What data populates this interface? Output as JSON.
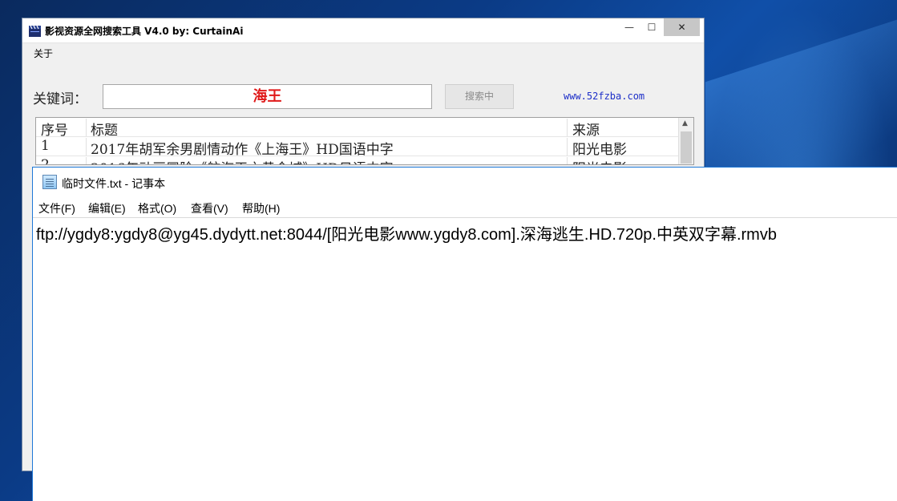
{
  "search_app": {
    "title": "影视资源全网搜索工具 V4.0 by:  CurtainAi",
    "menu": {
      "about": "关于"
    },
    "window_controls": {
      "minimize": "—",
      "maximize": "☐",
      "close": "✕"
    },
    "keyword_label": "关键词：",
    "keyword_value": "海王",
    "search_button_label": "搜索中",
    "site_link": "www.52fzba.com",
    "table": {
      "headers": [
        "序号",
        "标题",
        "来源"
      ],
      "rows": [
        [
          "1",
          "2017年胡军余男剧情动作《上海王》HD国语中字",
          "阳光电影"
        ],
        [
          "2",
          "2016年动画冒险《航海王之黄金城》HD日语中字",
          "阳光电影"
        ]
      ]
    }
  },
  "notepad": {
    "title": "临时文件.txt - 记事本",
    "menu": [
      "文件(F)",
      "编辑(E)",
      "格式(O)",
      "查看(V)",
      "帮助(H)"
    ],
    "content": "ftp://ygdy8:ygdy8@yg45.dydytt.net:8044/[阳光电影www.ygdy8.com].深海逃生.HD.720p.中英双字幕.rmvb"
  }
}
